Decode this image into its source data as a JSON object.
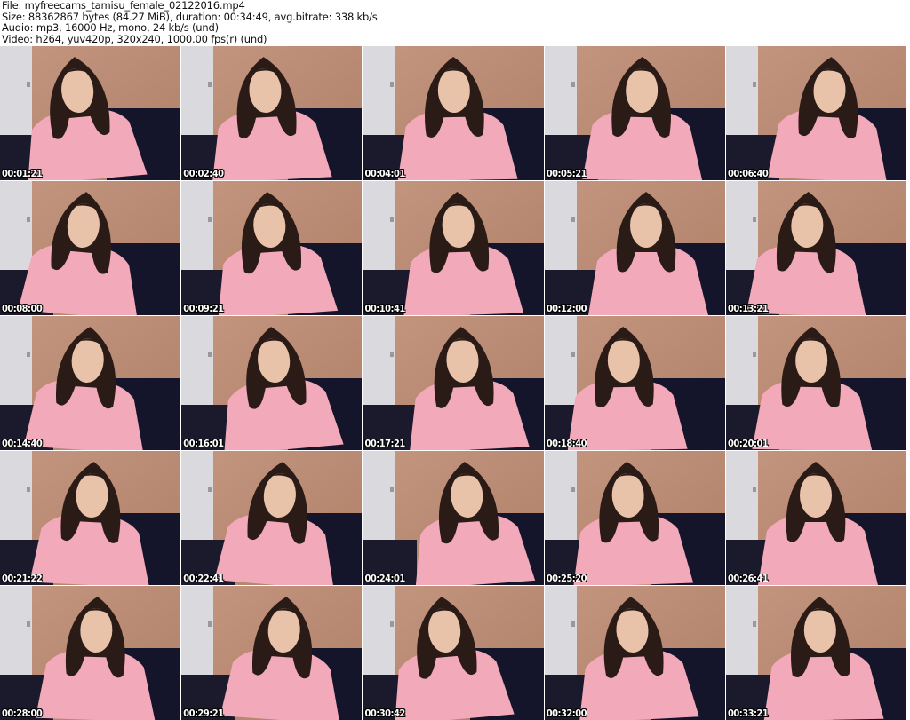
{
  "header": {
    "file": "File: myfreecams_tamisu_female_02122016.mp4",
    "size": "Size: 88362867 bytes (84.27 MiB), duration: 00:34:49, avg.bitrate: 338 kb/s",
    "audio": "Audio: mp3, 16000 Hz, mono, 24 kb/s (und)",
    "video": "Video: h264, yuv420p, 320x240, 1000.00 fps(r) (und)"
  },
  "thumbnails": [
    "00:01:21",
    "00:02:40",
    "00:04:01",
    "00:05:21",
    "00:06:40",
    "00:08:00",
    "00:09:21",
    "00:10:41",
    "00:12:00",
    "00:13:21",
    "00:14:40",
    "00:16:01",
    "00:17:21",
    "00:18:40",
    "00:20:01",
    "00:21:22",
    "00:22:41",
    "00:24:01",
    "00:25:20",
    "00:26:41",
    "00:28:00",
    "00:29:21",
    "00:30:42",
    "00:32:00",
    "00:33:21"
  ],
  "colors": {
    "wall": "#b08068",
    "door": "#d9d9de",
    "sweater": "#f2a9ba",
    "hair": "#2b1b17",
    "skin": "#e9c2aa",
    "dark_bg": "#14142a"
  }
}
